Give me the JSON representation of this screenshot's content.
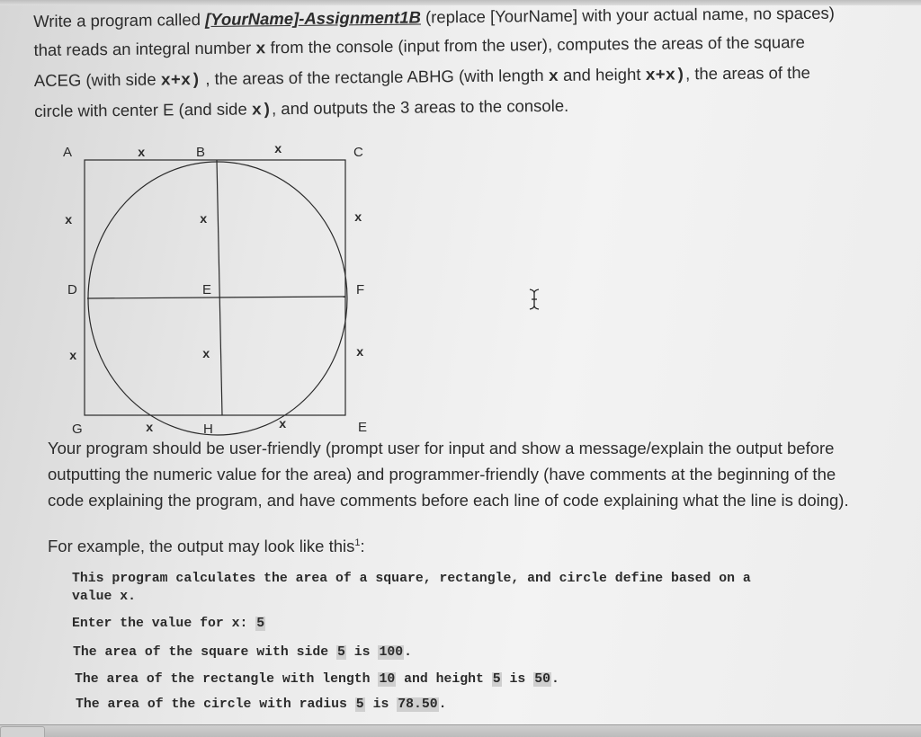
{
  "intro": {
    "line1_a": "Write a program called ",
    "line1_name": "[YourName]-Assignment1B",
    "line1_b": " (replace [YourName] with your actual name, no spaces)",
    "line2_a": "that reads an integral number ",
    "line2_x": "x",
    "line2_b": " from the console (input from the user), computes the areas of the square",
    "line3_a": "ACEG (with side ",
    "line3_xx": "x+x)",
    "line3_b": " , the areas of the rectangle ABHG (with length ",
    "line3_x": "x",
    "line3_c": " and height ",
    "line3_xx2": "x+x)",
    "line3_d": ", the areas of the",
    "line4_a": "circle with center E (and side ",
    "line4_x": "x)",
    "line4_b": ", and outputs the 3 areas to the console."
  },
  "diagram": {
    "points": [
      "A",
      "B",
      "C",
      "D",
      "E",
      "F",
      "G",
      "H",
      "E"
    ],
    "side_label": "x"
  },
  "requirements": {
    "line1": "Your program should be user-friendly (prompt user for input and show a message/explain the output before",
    "line2": "outputting the numeric value for the area) and programmer-friendly (have comments at the beginning of the",
    "line3": "code explaining the program, and have comments before each line of code explaining what the line is doing)."
  },
  "example": {
    "intro": "For example, the output may look like this",
    "footnote": "1",
    "colon": ":"
  },
  "console": {
    "line1": "This program calculates the area of a square, rectangle, and circle define based on a",
    "line2": "value x.",
    "prompt": "Enter the value for x: ",
    "input_value": "5",
    "square_a": "The area of the square with side ",
    "square_side": "5",
    "square_b": " is ",
    "square_area": "100",
    "rect_a": "The area of the rectangle with length ",
    "rect_length": "10",
    "rect_b": " and height ",
    "rect_height": "5",
    "rect_c": " is ",
    "rect_area": "50",
    "circle_a": "The area of the circle with radius ",
    "circle_radius": "5",
    "circle_b": " is ",
    "circle_area": "78.50",
    "period": "."
  }
}
